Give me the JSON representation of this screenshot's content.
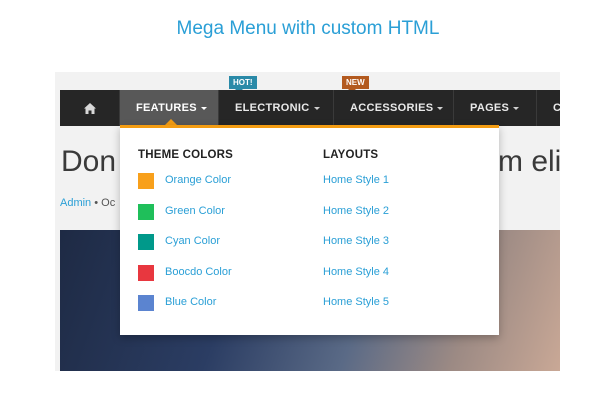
{
  "heading": "Mega Menu with custom HTML",
  "nav": {
    "items": [
      {
        "label": "FEATURES"
      },
      {
        "label": "ELECTRONIC"
      },
      {
        "label": "ACCESSORIES"
      },
      {
        "label": "PAGES"
      },
      {
        "label": "C"
      }
    ],
    "badges": {
      "hot": "HOT!",
      "new": "NEW"
    }
  },
  "post": {
    "title_left": "Don",
    "title_right": "m elit",
    "author": "Admin",
    "meta_rest": " • Oc"
  },
  "mega_menu": {
    "theme_colors_title": "THEME COLORS",
    "layouts_title": "LAYOUTS",
    "theme_colors": [
      {
        "label": "Orange Color",
        "color": "#f8a01b"
      },
      {
        "label": "Green Color",
        "color": "#1fbf5a"
      },
      {
        "label": "Cyan Color",
        "color": "#00998a"
      },
      {
        "label": "Boocdo Color",
        "color": "#e8373f"
      },
      {
        "label": "Blue Color",
        "color": "#5b84d0"
      }
    ],
    "layouts": [
      {
        "label": "Home Style 1"
      },
      {
        "label": "Home Style 2"
      },
      {
        "label": "Home Style 3"
      },
      {
        "label": "Home Style 4"
      },
      {
        "label": "Home Style 5"
      }
    ]
  },
  "colors": {
    "accent": "#f39c12",
    "link": "#2a9fd6",
    "navbar": "#262626"
  }
}
